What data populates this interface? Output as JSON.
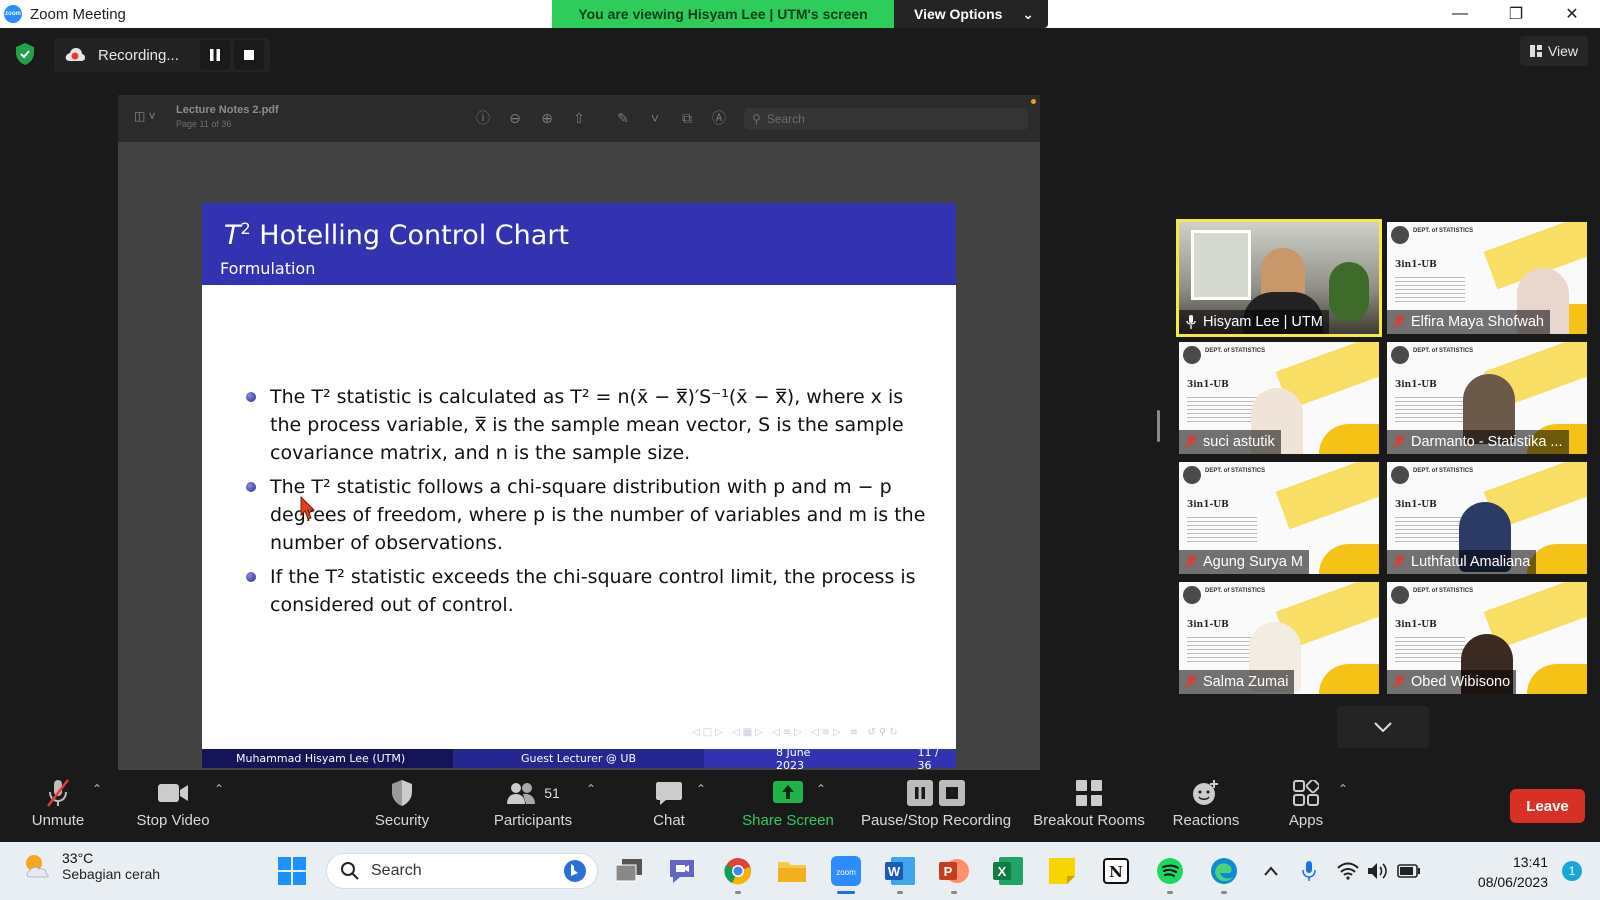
{
  "window": {
    "app_title": "Zoom Meeting",
    "app_icon_text": "zoom"
  },
  "share_banner": {
    "viewing_text": "You are viewing Hisyam Lee | UTM's screen",
    "view_options_label": "View Options"
  },
  "recording": {
    "label": "Recording..."
  },
  "view_button": {
    "label": "View"
  },
  "pdf_viewer": {
    "file_name": "Lecture Notes 2.pdf",
    "page_info": "Page 11 of 36",
    "search_placeholder": "Search"
  },
  "slide": {
    "title_prefix": "T",
    "title_sup": "2",
    "title_rest": " Hotelling Control Chart",
    "subtitle": "Formulation",
    "bullets": [
      "The T² statistic is calculated as T² = n(x̄ − x̿)′S⁻¹(x̄ − x̿), where x is the process variable, x̿ is the sample mean vector, S is the sample covariance matrix, and n is the sample size.",
      "The T² statistic follows a chi-square distribution with p and m − p degrees of freedom, where p is the number of variables and m is the number of observations.",
      "If the T² statistic exceeds the chi-square control limit, the process is considered out of control."
    ],
    "footer": {
      "author": "Muhammad Hisyam Lee  (UTM)",
      "role": "Guest Lecturer @ UB",
      "date": "8 June 2023",
      "page": "11 / 36"
    }
  },
  "participants_gallery": [
    {
      "name": "Hisyam Lee | UTM",
      "muted": false,
      "active_speaker": true,
      "video": "camera"
    },
    {
      "name": "Elfira Maya Shofwah",
      "muted": true,
      "active_speaker": false,
      "video": "poster"
    },
    {
      "name": "suci astutik",
      "muted": true,
      "active_speaker": false,
      "video": "poster"
    },
    {
      "name": "Darmanto - Statistika ...",
      "muted": true,
      "active_speaker": false,
      "video": "poster"
    },
    {
      "name": "Agung Surya M",
      "muted": true,
      "active_speaker": false,
      "video": "poster"
    },
    {
      "name": "Luthfatul Amaliana",
      "muted": true,
      "active_speaker": false,
      "video": "poster"
    },
    {
      "name": "Salma Zumai",
      "muted": true,
      "active_speaker": false,
      "video": "poster"
    },
    {
      "name": "Obed Wibisono",
      "muted": true,
      "active_speaker": false,
      "video": "poster"
    }
  ],
  "poster": {
    "heading": "DEPT. of STATISTICS",
    "brand": "3in1-UB"
  },
  "controls": {
    "unmute": "Unmute",
    "stop_video": "Stop Video",
    "security": "Security",
    "participants": "Participants",
    "participants_count": "51",
    "chat": "Chat",
    "share_screen": "Share Screen",
    "pause_stop_recording": "Pause/Stop Recording",
    "breakout_rooms": "Breakout Rooms",
    "reactions": "Reactions",
    "apps": "Apps",
    "leave": "Leave"
  },
  "taskbar": {
    "temperature": "33°C",
    "weather_condition": "Sebagian cerah",
    "search_label": "Search",
    "time": "13:41",
    "date": "08/06/2023",
    "notification_count": "1"
  },
  "colors": {
    "zoom_blue": "#2d8cff",
    "share_green": "#2ecc5a",
    "leave_red": "#d93025",
    "slide_header": "#3333b2",
    "active_speaker": "#f5e94a"
  }
}
